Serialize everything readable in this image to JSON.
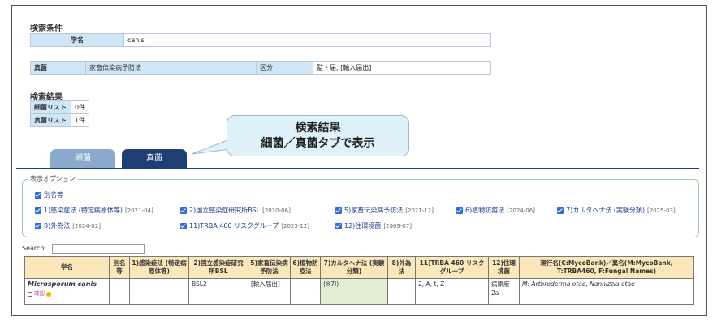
{
  "search_conditions": {
    "title": "検索条件",
    "name_label": "学名",
    "name_value": "canis",
    "fungi_label": "真菌",
    "law_label": "家畜伝染病予防法",
    "category_label": "区分",
    "category_value": "監・届, [輸入届出]"
  },
  "search_results": {
    "title": "検索結果",
    "bacteria_label": "細菌リスト",
    "bacteria_count": "0件",
    "fungi_label": "真菌リスト",
    "fungi_count": "1件"
  },
  "callout": {
    "line1": "検索結果",
    "line2": "細菌／真菌タブで表示"
  },
  "tabs": [
    {
      "label": "細菌",
      "active": false
    },
    {
      "label": "真菌",
      "active": true
    }
  ],
  "options": {
    "legend": "表示オプション",
    "items": [
      {
        "label": "別名等",
        "date": ""
      },
      {
        "label": "1)感染症法 (特定病原体等)",
        "date": "[2021-04]"
      },
      {
        "label": "2)国立感染症研究所BSL",
        "date": "[2010-06]"
      },
      {
        "label": "5)家畜伝染病予防法",
        "date": "[2021-12]"
      },
      {
        "label": "6)植物防疫法",
        "date": "[2024-06]"
      },
      {
        "label": "7)カルタヘナ法 (実験分類)",
        "date": "[2025-03]"
      },
      {
        "label": "8)外為法",
        "date": "[2024-02]"
      },
      {
        "label": "11)TRBA 460 リスクグループ",
        "date": "[2023-12]"
      },
      {
        "label": "12)住環境菌",
        "date": "[2009-07]"
      }
    ]
  },
  "search": {
    "label": "Search:",
    "value": ""
  },
  "table": {
    "headers": [
      "学名",
      "別名等",
      "1)感染症法 (特定病原体等)",
      "2)国立感染症研究所BSL",
      "5)家畜伝染病予防法",
      "6)植物防疫法",
      "7)カルタヘナ法 (実験分類)",
      "8)外為法",
      "11)TRBA 460 リスクグループ",
      "12)住環境菌",
      "現行名(C:MycoBank)／異名(M:MycoBank, T:TRBA460, F:Fungal Names)"
    ],
    "rows": [
      {
        "name": "Microsporum canis",
        "confirm": "確認",
        "alias": "",
        "law1": "",
        "bsl": "BSL2",
        "law5": "[輸入届出]",
        "law6": "",
        "cartagena": "(※7I)",
        "law8": "",
        "trba": "2, A, t, Z",
        "env": "病原度2a",
        "current_name": "M: Arthroderma otae, Nannizzia otae"
      }
    ]
  },
  "colors": {
    "tab_active": "#1f3e73",
    "tab_inactive": "#8ba8cd",
    "header_cell": "#cfe6f7",
    "table_header": "#fbe7b9",
    "cartagena_cell": "#e3efd3",
    "checkbox": "#2f6fd6"
  }
}
